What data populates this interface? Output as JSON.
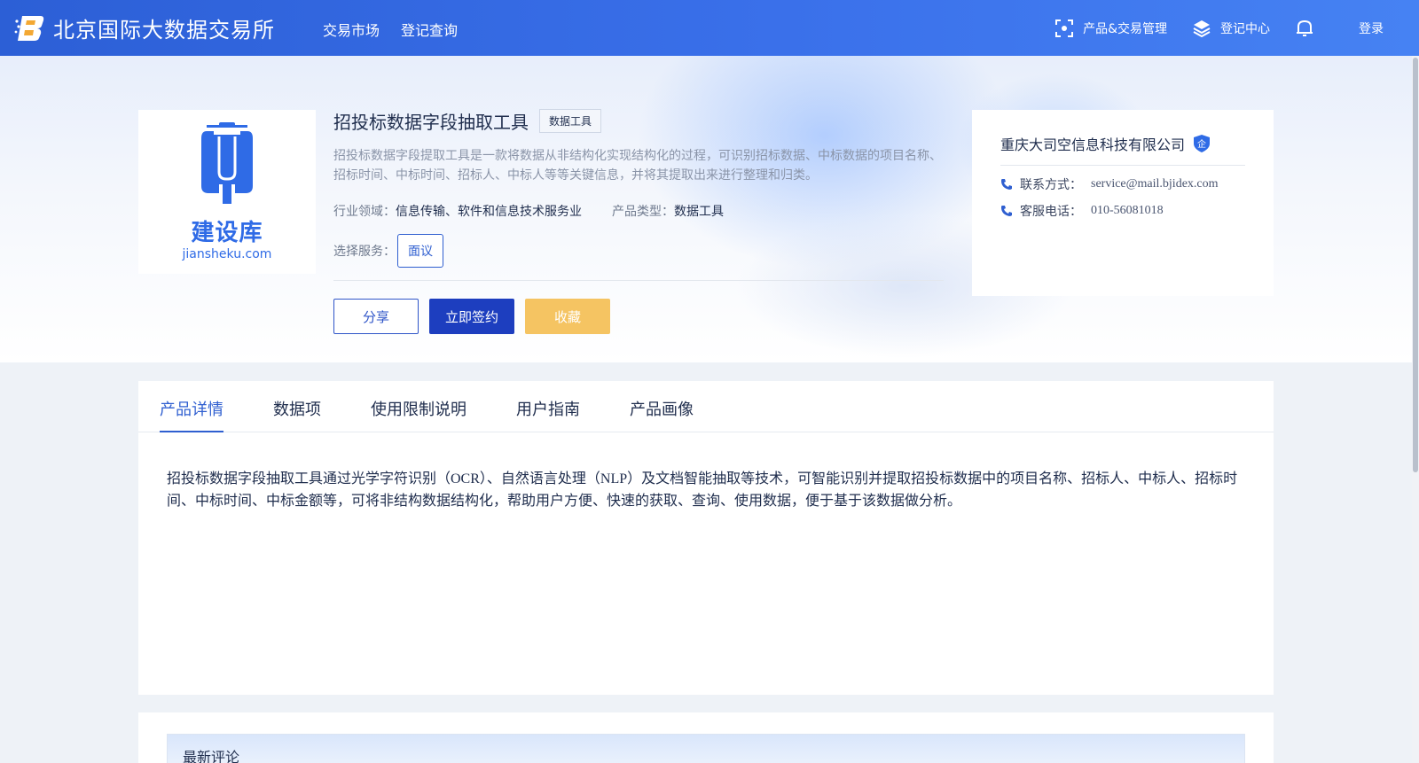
{
  "header": {
    "site_name": "北京国际大数据交易所",
    "nav": [
      {
        "label": "交易市场"
      },
      {
        "label": "登记查询"
      }
    ],
    "menu": [
      {
        "label": "产品&交易管理",
        "icon": "scan-icon"
      },
      {
        "label": "登记中心",
        "icon": "layers-icon"
      }
    ],
    "bell_icon": "bell-icon",
    "login_label": "登录"
  },
  "product": {
    "logo": {
      "cn": "建设库",
      "en": "jiansheku.com"
    },
    "title": "招投标数据字段抽取工具",
    "tag": "数据工具",
    "description": "招投标数据字段提取工具是一款将数据从非结构化实现结构化的过程，可识别招标数据、中标数据的项目名称、招标时间、中标时间、招标人、中标人等等关键信息，并将其提取出来进行整理和归类。",
    "industry_label": "行业领域：",
    "industry_value": "信息传输、软件和信息技术服务业",
    "type_label": "产品类型：",
    "type_value": "数据工具",
    "service_label": "选择服务：",
    "service_option": "面议",
    "actions": {
      "share": "分享",
      "sign": "立即签约",
      "favorite": "收藏"
    }
  },
  "company": {
    "name": "重庆大司空信息科技有限公司",
    "badge": "企",
    "contact_label": "联系方式：",
    "contact_value": "service@mail.bjidex.com",
    "phone_label": "客服电话：",
    "phone_value": "010-56081018"
  },
  "tabs": [
    {
      "label": "产品详情",
      "active": true
    },
    {
      "label": "数据项",
      "active": false
    },
    {
      "label": "使用限制说明",
      "active": false
    },
    {
      "label": "用户指南",
      "active": false
    },
    {
      "label": "产品画像",
      "active": false
    }
  ],
  "detail_text": "招投标数据字段抽取工具通过光学字符识别（OCR）、自然语言处理（NLP）及文档智能抽取等技术，可智能识别并提取招投标数据中的项目名称、招标人、中标人、招标时间、中标时间、中标金额等，可将非结构数据结构化，帮助用户方便、快速的获取、查询、使用数据，便于基于该数据做分析。",
  "comments": {
    "title": "最新评论"
  },
  "colors": {
    "primary": "#2f5fd0",
    "header": "#3a70ea",
    "favorite": "#f5c462",
    "sign": "#1d3ebf"
  }
}
